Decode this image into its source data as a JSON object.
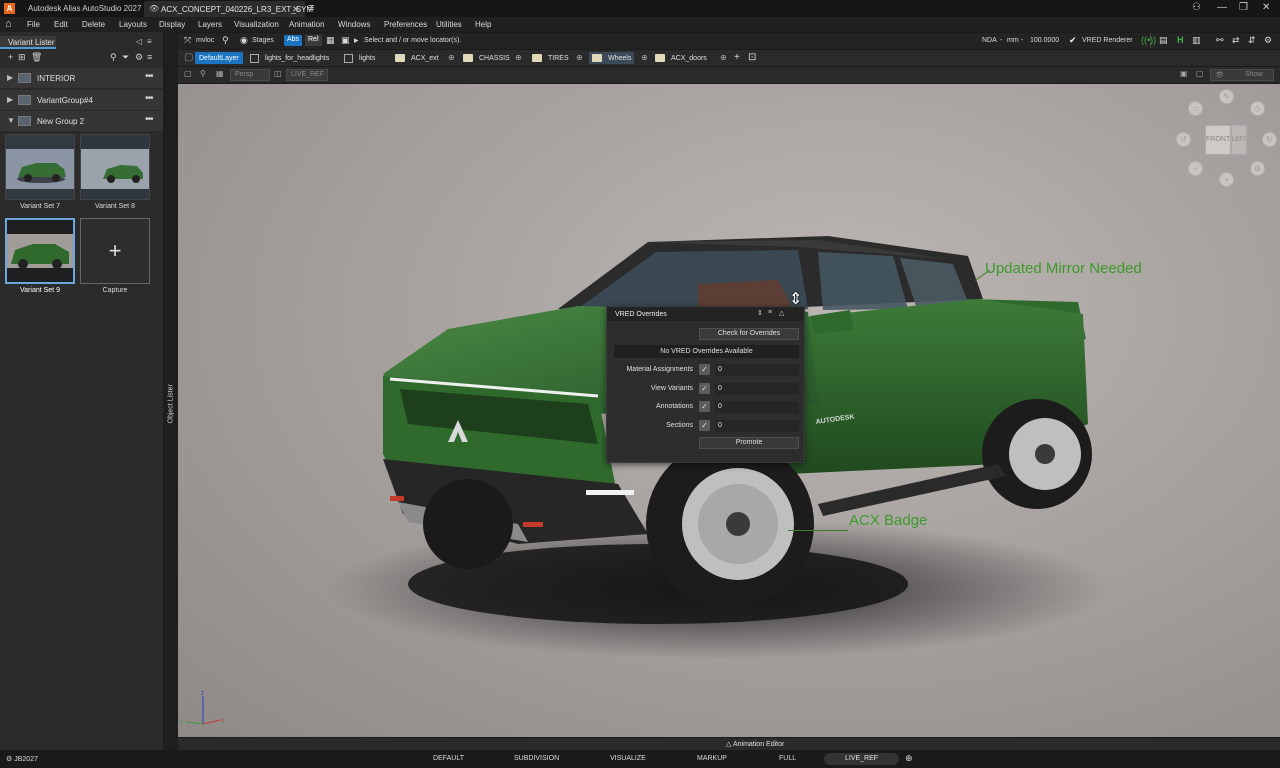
{
  "window": {
    "app_title": "Autodesk Alias AutoStudio 2027",
    "document_tab": "ACX_CONCEPT_040226_LR3_EXT_SYM",
    "app_logo_letter": "A"
  },
  "menu": {
    "items": [
      "File",
      "Edit",
      "Delete",
      "Layouts",
      "Display",
      "Layers",
      "Visualization",
      "Animation",
      "Windows",
      "Preferences",
      "Utilities",
      "Help"
    ]
  },
  "left_panel": {
    "tab_label": "Variant Lister",
    "groups": [
      {
        "label": "INTERIOR",
        "expanded": false
      },
      {
        "label": "VariantGroup#4",
        "expanded": false
      },
      {
        "label": "New Group 2",
        "expanded": true
      }
    ],
    "variants": [
      {
        "label": "Variant Set 7",
        "selected": false
      },
      {
        "label": "Variant Set 8",
        "selected": false
      },
      {
        "label": "Variant Set 9",
        "selected": true
      },
      {
        "label": "Capture",
        "selected": false
      }
    ],
    "capture_glyph": "+",
    "object_lister_label": "Object Lister"
  },
  "toolbar1": {
    "mvloc": "mvloc",
    "stages": "Stages",
    "abs": "Abs",
    "rel": "Rel",
    "prompt": "Select and / or move locator(s).",
    "nda": "NDA",
    "units": "mm",
    "scale": "100.0000",
    "renderer": "VRED Renderer"
  },
  "layers": [
    {
      "label": "DefaultLayer",
      "kind": "active"
    },
    {
      "label": "lights_for_headlights",
      "kind": "box"
    },
    {
      "label": "lights",
      "kind": "box"
    },
    {
      "label": "ACX_ext",
      "kind": "folder"
    },
    {
      "label": "CHASSIS",
      "kind": "folder"
    },
    {
      "label": "TIRES",
      "kind": "folder"
    },
    {
      "label": "Wheels",
      "kind": "selected"
    },
    {
      "label": "ACX_doors",
      "kind": "folder"
    }
  ],
  "viewport_header": {
    "camera": "Persp",
    "ref": "LIVE_REF",
    "show": "Show"
  },
  "annotations": [
    {
      "text": "Updated Mirror Needed"
    },
    {
      "text": "ACX Badge"
    }
  ],
  "vred_overrides": {
    "title": "VRED Overrides",
    "check_button": "Check for Overrides",
    "banner": "No VRED Overrides Available",
    "rows": [
      {
        "label": "Material Assignments",
        "checked": true,
        "value": "0"
      },
      {
        "label": "View Variants",
        "checked": true,
        "value": "0"
      },
      {
        "label": "Annotations",
        "checked": true,
        "value": "0"
      },
      {
        "label": "Sections",
        "checked": true,
        "value": "0"
      }
    ],
    "promote_button": "Promote"
  },
  "viewcube": {
    "front": "FRONT",
    "left": "LEFT"
  },
  "vehicle_badge": "AUTODESK",
  "axis": {
    "x": "x",
    "y": "y",
    "z": "z"
  },
  "bottom": {
    "animation_editor": "Animation Editor",
    "user": "JB2027",
    "modes": [
      "DEFAULT",
      "SUBDIVISION",
      "VISUALIZE",
      "MARKUP",
      "FULL",
      "LIVE_REF"
    ],
    "active_mode": "LIVE_REF"
  },
  "colors": {
    "accent": "#1a74c2",
    "annotation_green": "#3e9a2c",
    "truck_green": "#2f6a2c",
    "renderer_green": "#3fb24a"
  }
}
